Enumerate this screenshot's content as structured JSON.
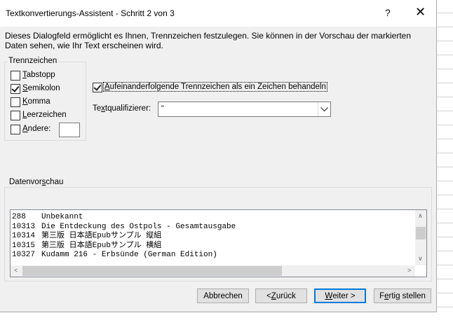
{
  "window": {
    "title": "Textkonvertierungs-Assistent - Schritt 2 von 3",
    "help_label": "?",
    "close_label": "✕"
  },
  "description": "Dieses Dialogfeld ermöglicht es Ihnen, Trennzeichen festzulegen. Sie können in der Vorschau der markierten Daten sehen, wie Ihr Text erscheinen wird.",
  "delimiters": {
    "group_label": "Trennzeichen",
    "tab": {
      "label_pre": "",
      "accel": "T",
      "label_post": "abstopp",
      "checked": false
    },
    "semicolon": {
      "label_pre": "",
      "accel": "S",
      "label_post": "emikolon",
      "checked": true
    },
    "comma": {
      "label_pre": "",
      "accel": "K",
      "label_post": "omma",
      "checked": false
    },
    "space": {
      "label_pre": "",
      "accel": "L",
      "label_post": "eerzeichen",
      "checked": false
    },
    "other": {
      "label_pre": "",
      "accel": "A",
      "label_post": "ndere:",
      "checked": false,
      "value": ""
    }
  },
  "consecutive": {
    "accel": "A",
    "label_post": "ufeinanderfolgende Trennzeichen als ein Zeichen behandeln",
    "checked": true
  },
  "qualifier": {
    "label_pre": "Te",
    "accel": "x",
    "label_post": "tqualifizierer:",
    "value": "\""
  },
  "preview": {
    "group_label_pre": "Datenvor",
    "group_accel": "s",
    "group_label_post": "chau",
    "rows": [
      [
        "288",
        "Unbekannt"
      ],
      [
        "10313",
        "Die Entdeckung des Ostpols - Gesamtausgabe"
      ],
      [
        "10314",
        "第三版 日本語Epubサンプル 縦組"
      ],
      [
        "10315",
        "第三版 日本語Epubサンプル 横組"
      ],
      [
        "10327",
        "Kudamm 216 - Erbsünde (German Edition)"
      ]
    ]
  },
  "buttons": {
    "cancel": "Abbrechen",
    "back_pre": "< ",
    "back_accel": "Z",
    "back_post": "urück",
    "next_accel": "W",
    "next_post": "eiter >",
    "finish_pre": "F",
    "finish_accel": "e",
    "finish_post": "rtig stellen"
  },
  "colors": {
    "dialog_bg": "#f0f0f0",
    "default_button_border": "#0078d7"
  }
}
